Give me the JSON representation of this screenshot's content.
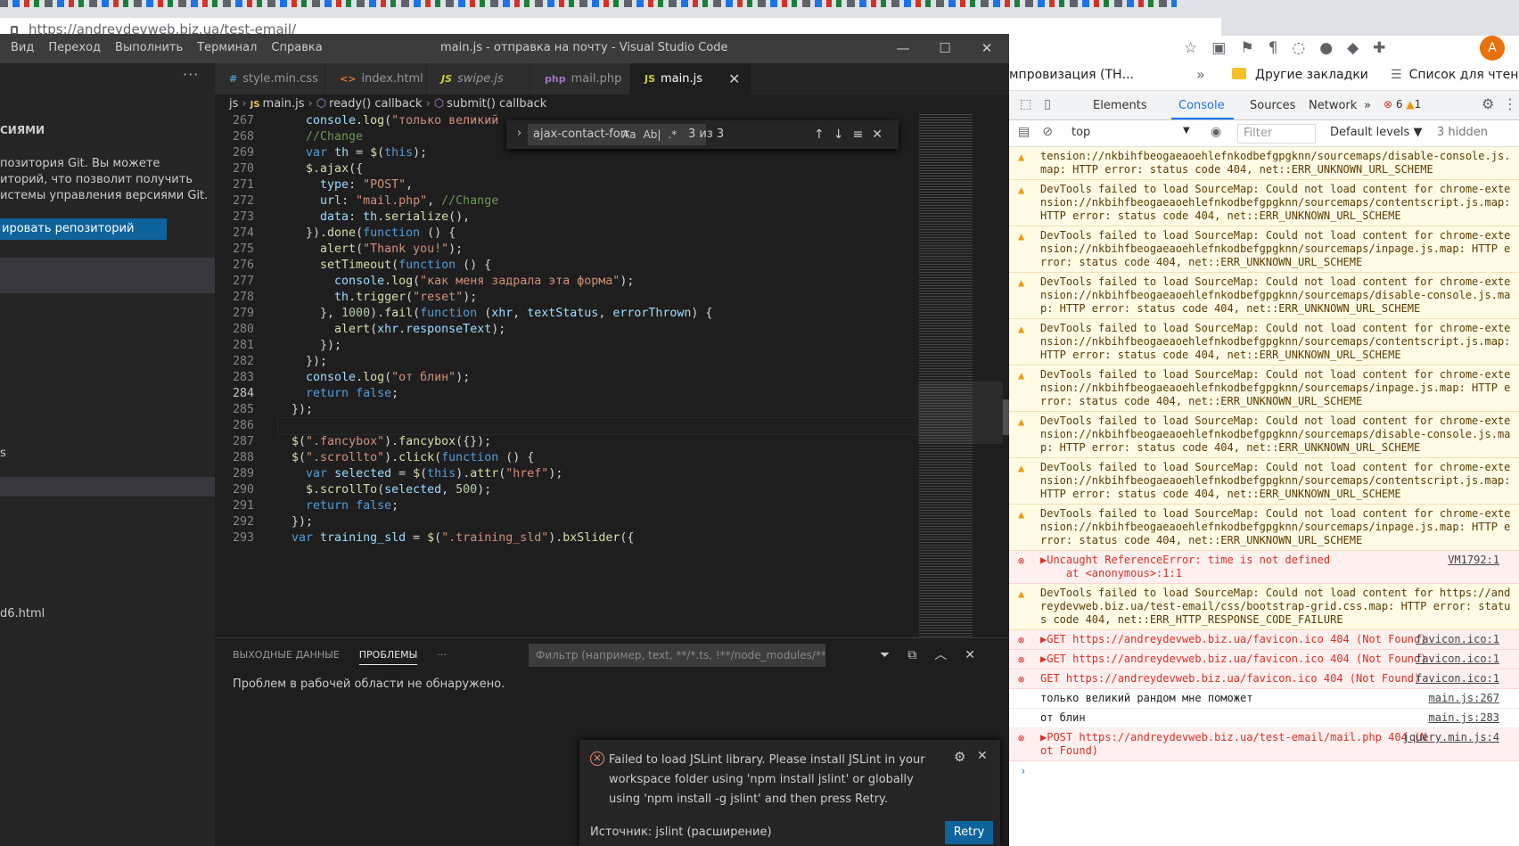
{
  "browser": {
    "url": "https://andreydevweb.biz.ua/test-email/"
  },
  "vscode": {
    "menu": [
      "Вид",
      "Переход",
      "Выполнить",
      "Терминал",
      "Справка"
    ],
    "window_title": "main.js - отправка на почту - Visual Studio Code",
    "sidebar": {
      "section_title": "СИЯМИ",
      "info_lines": [
        "позитория Git. Вы можете",
        "иторий, что позволит получить",
        "истемы управления версиями Git."
      ],
      "clone_button": "ировать репозиторий",
      "item_s": "s",
      "file_item": "d6.html"
    },
    "tabs": [
      {
        "icon": "#",
        "label": "style.min.css"
      },
      {
        "icon": "<>",
        "label": "index.html"
      },
      {
        "icon": "JS",
        "label": "swipe.js"
      },
      {
        "icon": "php",
        "label": "mail.php"
      },
      {
        "icon": "JS",
        "label": "main.js"
      }
    ],
    "breadcrumb": [
      "js",
      "main.js",
      "ready() callback",
      "submit() callback"
    ],
    "find": {
      "query": "ajax-contact-forr",
      "opt_case": "Aa",
      "opt_word": "Ab|",
      "opt_regex": ".*",
      "count": "3 из 3"
    },
    "line_numbers": [
      "267",
      "268",
      "269",
      "270",
      "271",
      "272",
      "273",
      "274",
      "275",
      "276",
      "277",
      "278",
      "279",
      "280",
      "281",
      "282",
      "283",
      "284",
      "285",
      "286",
      "287",
      "288",
      "289",
      "290",
      "291",
      "292",
      "293"
    ],
    "panel": {
      "tab_output": "ВЫХОДНЫЕ ДАННЫЕ",
      "tab_problems": "ПРОБЛЕМЫ",
      "filter_placeholder": "Фильтр (например, text, **/*.ts, !**/node_modules/**)",
      "message": "Проблем в рабочей области не обнаружено."
    },
    "notification": {
      "text": "Failed to load JSLint library. Please install JSLint in your workspace folder using 'npm install jslint' or globally using 'npm install -g jslint' and then press Retry.",
      "source": "Источник: jslint (расширение)",
      "retry": "Retry"
    }
  },
  "chrome": {
    "avatar_letter": "A",
    "bookmarks": {
      "item1": "мпровизация (ТН...",
      "item2": "Другие закладки",
      "item3": "Список для чтени"
    },
    "devtools": {
      "tabs": [
        "Elements",
        "Console",
        "Sources",
        "Network"
      ],
      "errors_count": "6",
      "warnings_count": "1",
      "context": "top",
      "filter_placeholder": "Filter",
      "levels": "Default levels",
      "hidden": "3 hidden"
    },
    "console_messages": [
      {
        "type": "warn",
        "cont": true,
        "text": "tension://nkbihfbeogaeaoehlefnkodbefgpgknn/sourcemaps/disable-console.js.map: HTTP error: status code 404, net::ERR_UNKNOWN_URL_SCHEME"
      },
      {
        "type": "warn",
        "text": "DevTools failed to load SourceMap: Could not load content for chrome-extension://nkbihfbeogaeaoehlefnkodbefgpgknn/sourcemaps/contentscript.js.map: HTTP error: status code 404, net::ERR_UNKNOWN_URL_SCHEME"
      },
      {
        "type": "warn",
        "text": "DevTools failed to load SourceMap: Could not load content for chrome-extension://nkbihfbeogaeaoehlefnkodbefgpgknn/sourcemaps/inpage.js.map: HTTP error: status code 404, net::ERR_UNKNOWN_URL_SCHEME"
      },
      {
        "type": "warn",
        "text": "DevTools failed to load SourceMap: Could not load content for chrome-extension://nkbihfbeogaeaoehlefnkodbefgpgknn/sourcemaps/disable-console.js.map: HTTP error: status code 404, net::ERR_UNKNOWN_URL_SCHEME"
      },
      {
        "type": "warn",
        "text": "DevTools failed to load SourceMap: Could not load content for chrome-extension://nkbihfbeogaeaoehlefnkodbefgpgknn/sourcemaps/contentscript.js.map: HTTP error: status code 404, net::ERR_UNKNOWN_URL_SCHEME"
      },
      {
        "type": "warn",
        "text": "DevTools failed to load SourceMap: Could not load content for chrome-extension://nkbihfbeogaeaoehlefnkodbefgpgknn/sourcemaps/inpage.js.map: HTTP error: status code 404, net::ERR_UNKNOWN_URL_SCHEME"
      },
      {
        "type": "warn",
        "text": "DevTools failed to load SourceMap: Could not load content for chrome-extension://nkbihfbeogaeaoehlefnkodbefgpgknn/sourcemaps/disable-console.js.map: HTTP error: status code 404, net::ERR_UNKNOWN_URL_SCHEME"
      },
      {
        "type": "warn",
        "text": "DevTools failed to load SourceMap: Could not load content for chrome-extension://nkbihfbeogaeaoehlefnkodbefgpgknn/sourcemaps/contentscript.js.map: HTTP error: status code 404, net::ERR_UNKNOWN_URL_SCHEME"
      },
      {
        "type": "warn",
        "text": "DevTools failed to load SourceMap: Could not load content for chrome-extension://nkbihfbeogaeaoehlefnkodbefgpgknn/sourcemaps/inpage.js.map: HTTP error: status code 404, net::ERR_UNKNOWN_URL_SCHEME"
      },
      {
        "type": "err",
        "text": "▶Uncaught ReferenceError: time is not defined\n    at <anonymous>:1:1",
        "src": "VM1792:1"
      },
      {
        "type": "warn",
        "text": "DevTools failed to load SourceMap: Could not load content for https://andreydevweb.biz.ua/test-email/css/bootstrap-grid.css.map: HTTP error: status code 404, net::ERR_HTTP_RESPONSE_CODE_FAILURE"
      },
      {
        "type": "err",
        "text": "▶GET https://andreydevweb.biz.ua/favicon.ico 404 (Not Found)",
        "src": "favicon.ico:1"
      },
      {
        "type": "err",
        "text": "▶GET https://andreydevweb.biz.ua/favicon.ico 404 (Not Found)",
        "src": "favicon.ico:1"
      },
      {
        "type": "err",
        "text": "GET https://andreydevweb.biz.ua/favicon.ico 404 (Not Found)",
        "src": "favicon.ico:1"
      },
      {
        "type": "log",
        "text": "только великий рандом мне поможет",
        "src": "main.js:267"
      },
      {
        "type": "log",
        "text": "от блин",
        "src": "main.js:283"
      },
      {
        "type": "err",
        "text": "▶POST https://andreydevweb.biz.ua/test-email/mail.php 404 (Not Found)",
        "src": "jquery.min.js:4"
      }
    ]
  }
}
